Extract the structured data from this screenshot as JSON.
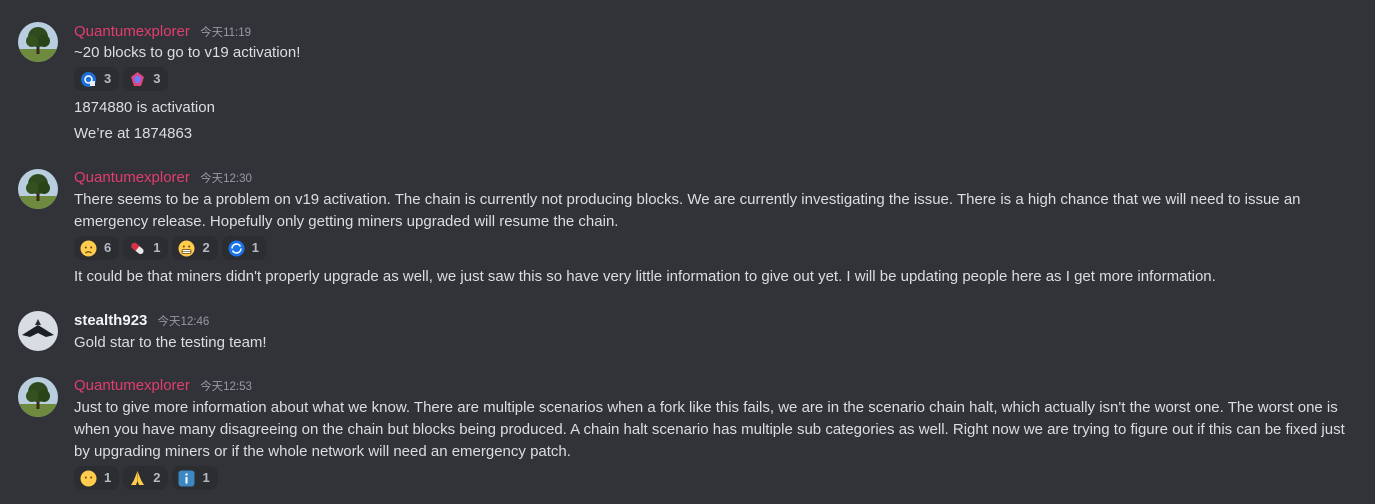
{
  "messages": [
    {
      "author": "Quantumexplorer",
      "time": "今天11:19",
      "lines": [
        "~20 blocks to go to v19 activation!"
      ],
      "reactions": [
        {
          "emoji": "network-globe-icon",
          "count": "3"
        },
        {
          "emoji": "pink-gem-icon",
          "count": "3"
        }
      ],
      "followups": [
        "1874880 is activation",
        "We’re at 1874863"
      ]
    },
    {
      "author": "Quantumexplorer",
      "time": "今天12:30",
      "text": "There seems to be a problem on v19 activation. The chain is currently not producing blocks. We are currently investigating the issue. There is a high chance that we will need to issue an emergency release. Hopefully only getting miners upgraded will resume the chain.",
      "reactions": [
        {
          "emoji": "worried-face-icon",
          "count": "6"
        },
        {
          "emoji": "pill-icon",
          "count": "1"
        },
        {
          "emoji": "grimacing-face-icon",
          "count": "2"
        },
        {
          "emoji": "blue-coin-icon",
          "count": "1"
        }
      ],
      "followups": [
        "It could be that miners didn't properly upgrade as well, we just saw this so have very little information to give out yet. I will be updating people here as I get more information."
      ]
    },
    {
      "author": "stealth923",
      "time": "今天12:46",
      "lines": [
        "Gold star to the testing team!"
      ]
    },
    {
      "author": "Quantumexplorer",
      "time": "今天12:53",
      "text": "Just to give more information about what we know. There are multiple scenarios when a fork like this fails, we are in the scenario chain halt, which actually isn't the worst one. The worst one is when you have many disagreeing on the chain but blocks being produced. A chain halt scenario has multiple sub categories as well. Right now we are trying to figure out if this can be fixed just by upgrading miners or if the whole network will need an emergency patch.",
      "reactions": [
        {
          "emoji": "neutral-face-icon",
          "count": "1"
        },
        {
          "emoji": "folded-hands-icon",
          "count": "2"
        },
        {
          "emoji": "information-icon",
          "count": "1"
        }
      ]
    }
  ],
  "colors": {
    "background": "#313338",
    "role_color": "#e33d6f",
    "text": "#dbdee1",
    "muted": "#949ba4",
    "reaction_bg": "#2b2d31"
  }
}
